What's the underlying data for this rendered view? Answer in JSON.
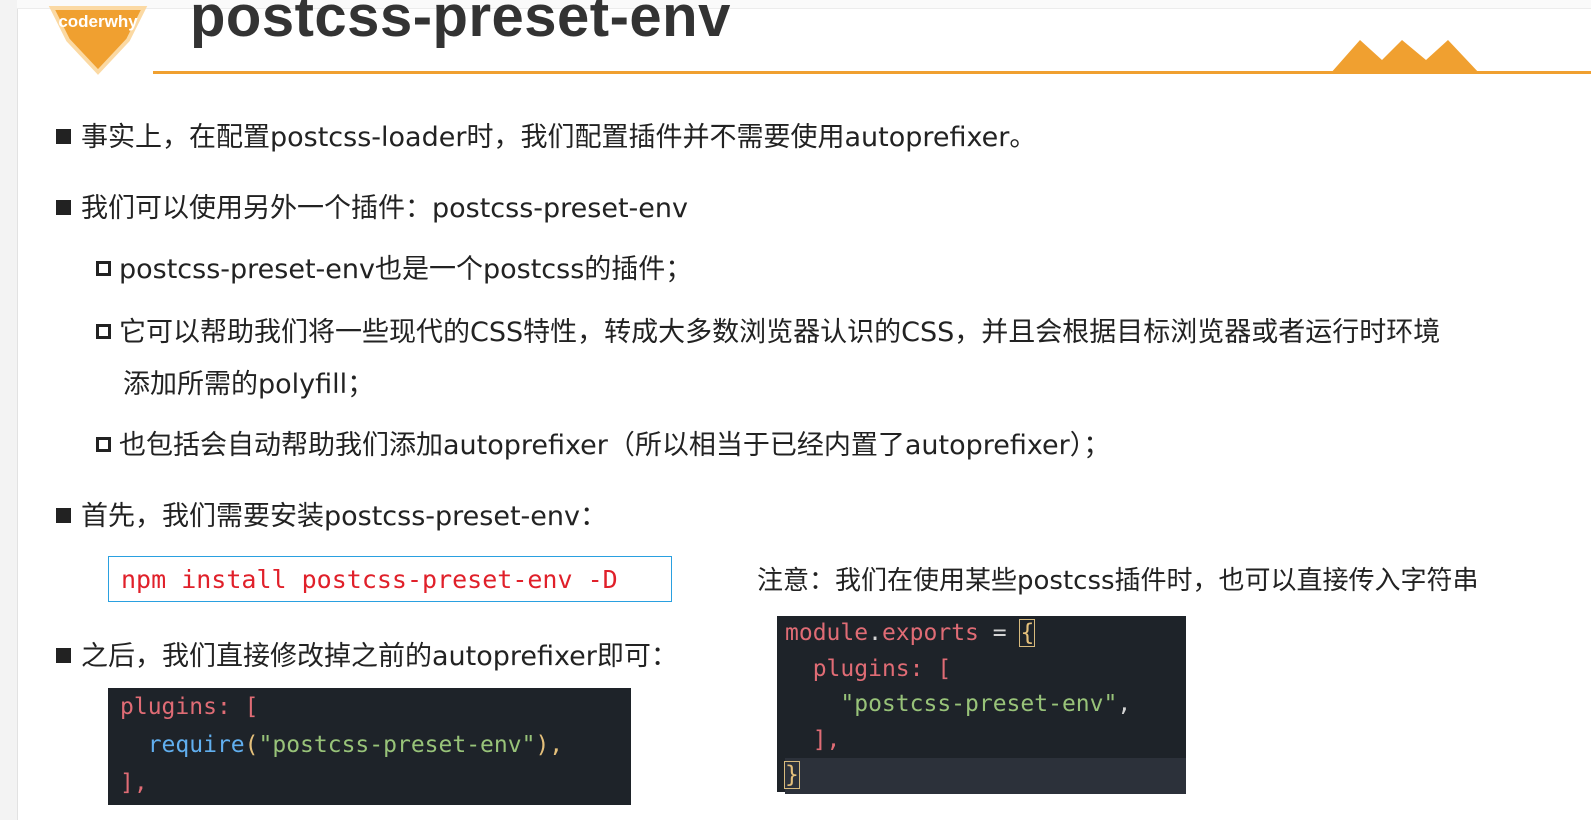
{
  "logo": {
    "text": "coderwhy",
    "color": "#f0a030"
  },
  "title": "postcss-preset-env",
  "bullets": [
    {
      "level": 1,
      "text": "事实上，在配置postcss-loader时，我们配置插件并不需要使用autoprefixer。"
    },
    {
      "level": 1,
      "text": "我们可以使用另外一个插件：postcss-preset-env"
    },
    {
      "level": 2,
      "text": "postcss-preset-env也是一个postcss的插件；"
    },
    {
      "level": 2,
      "text": "它可以帮助我们将一些现代的CSS特性，转成大多数浏览器认识的CSS，并且会根据目标浏览器或者运行时环境",
      "continuation": "添加所需的polyfill；"
    },
    {
      "level": 2,
      "text": "也包括会自动帮助我们添加autoprefixer（所以相当于已经内置了autoprefixer）；"
    },
    {
      "level": 1,
      "text": "首先，我们需要安装postcss-preset-env："
    },
    {
      "level": 1,
      "text": "之后，我们直接修改掉之前的autoprefixer即可："
    }
  ],
  "install_command": "npm install postcss-preset-env -D",
  "note": "注意：我们在使用某些postcss插件时，也可以直接传入字符串",
  "code_left": {
    "line1_key": "plugins",
    "line1_rest": ": [",
    "line2_fn": "require",
    "line2_open": "(",
    "line2_str": "\"postcss-preset-env\"",
    "line2_close": "),",
    "line3": "],"
  },
  "code_right": {
    "line1_obj": "module",
    "line1_dot": ".",
    "line1_prop": "exports",
    "line1_eq": " = ",
    "line1_brace": "{",
    "line2_key": "plugins",
    "line2_rest": ": [",
    "line3_str": "\"postcss-preset-env\"",
    "line3_comma": ",",
    "line4": "],",
    "line5": "}"
  },
  "colors": {
    "accent": "#f0a030",
    "command_text": "#e0202a",
    "command_border": "#2aa0e0",
    "code_bg": "#1e2329"
  }
}
